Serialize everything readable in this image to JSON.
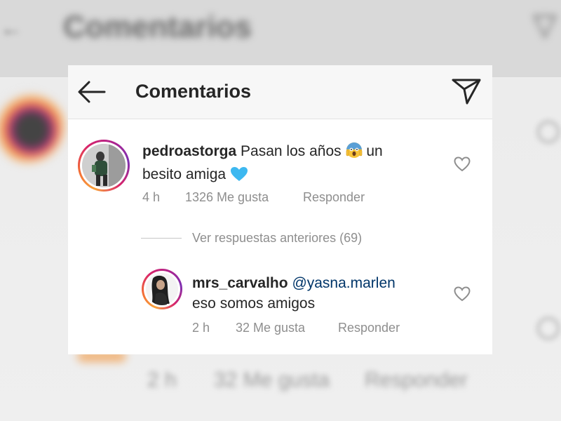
{
  "header": {
    "title": "Comentarios"
  },
  "background": {
    "title": "Comentarios",
    "row": [
      "2 h",
      "32 Me gusta",
      "Responder"
    ]
  },
  "comment": {
    "username": "pedroastorga",
    "text": "Pasan los años",
    "text_after": "un",
    "text_line2": "besito amiga",
    "time": "4 h",
    "likes": "1326 Me gusta",
    "reply_label": "Responder"
  },
  "view_previous": {
    "label": "Ver respuestas anteriores (69)"
  },
  "reply": {
    "username": "mrs_carvalho",
    "mention": "@yasna.marlen",
    "text": "eso somos amigos",
    "time": "2 h",
    "likes": "32 Me gusta",
    "reply_label": "Responder"
  },
  "colors": {
    "mention": "#003569",
    "meta_text": "#8e8e8e",
    "heart_emoji": "#3db8f0"
  },
  "icons": {
    "back": "arrow-left-icon",
    "send": "paper-plane-icon",
    "like": "heart-outline-icon",
    "emoji_scream": "face-screaming-in-fear-emoji",
    "emoji_heart": "blue-heart-emoji"
  }
}
